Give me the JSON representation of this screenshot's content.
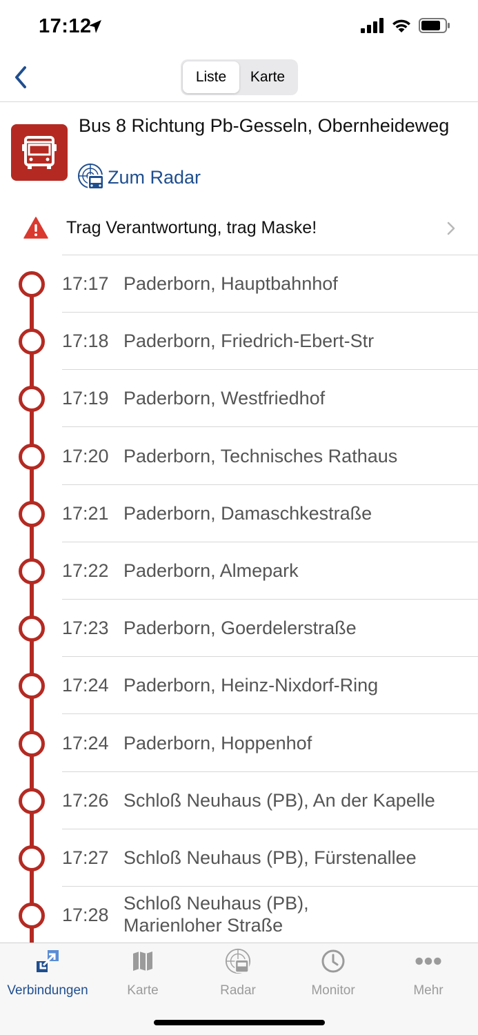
{
  "status_bar": {
    "time": "17:12"
  },
  "nav": {
    "segments": [
      "Liste",
      "Karte"
    ],
    "active_segment": "Liste"
  },
  "header": {
    "title": "Bus 8 Richtung Pb-Gesseln, Obernheideweg",
    "radar_link": "Zum Radar"
  },
  "warning": {
    "text": "Trag Verantwortung, trag Maske!"
  },
  "stops": [
    {
      "time": "17:17",
      "name": "Paderborn, Hauptbahnhof"
    },
    {
      "time": "17:18",
      "name": "Paderborn, Friedrich-Ebert-Str"
    },
    {
      "time": "17:19",
      "name": "Paderborn, Westfriedhof"
    },
    {
      "time": "17:20",
      "name": "Paderborn, Technisches Rathaus"
    },
    {
      "time": "17:21",
      "name": "Paderborn, Damaschkestraße"
    },
    {
      "time": "17:22",
      "name": "Paderborn, Almepark"
    },
    {
      "time": "17:23",
      "name": "Paderborn, Goerdelerstraße"
    },
    {
      "time": "17:24",
      "name": "Paderborn, Heinz-Nixdorf-Ring"
    },
    {
      "time": "17:24",
      "name": "Paderborn, Hoppenhof"
    },
    {
      "time": "17:26",
      "name": "Schloß Neuhaus (PB), An der Kapelle"
    },
    {
      "time": "17:27",
      "name": "Schloß Neuhaus (PB), Fürstenallee"
    },
    {
      "time": "17:28",
      "name": "Schloß Neuhaus (PB), Marienloher Straße"
    }
  ],
  "tabs": [
    {
      "label": "Verbindungen",
      "icon": "connections-icon",
      "active": true
    },
    {
      "label": "Karte",
      "icon": "map-icon",
      "active": false
    },
    {
      "label": "Radar",
      "icon": "radar-icon",
      "active": false
    },
    {
      "label": "Monitor",
      "icon": "clock-icon",
      "active": false
    },
    {
      "label": "Mehr",
      "icon": "more-icon",
      "active": false
    }
  ],
  "colors": {
    "accent_red": "#b42a22",
    "link_blue": "#1f4e8f",
    "tab_inactive": "#9b9b9b"
  }
}
